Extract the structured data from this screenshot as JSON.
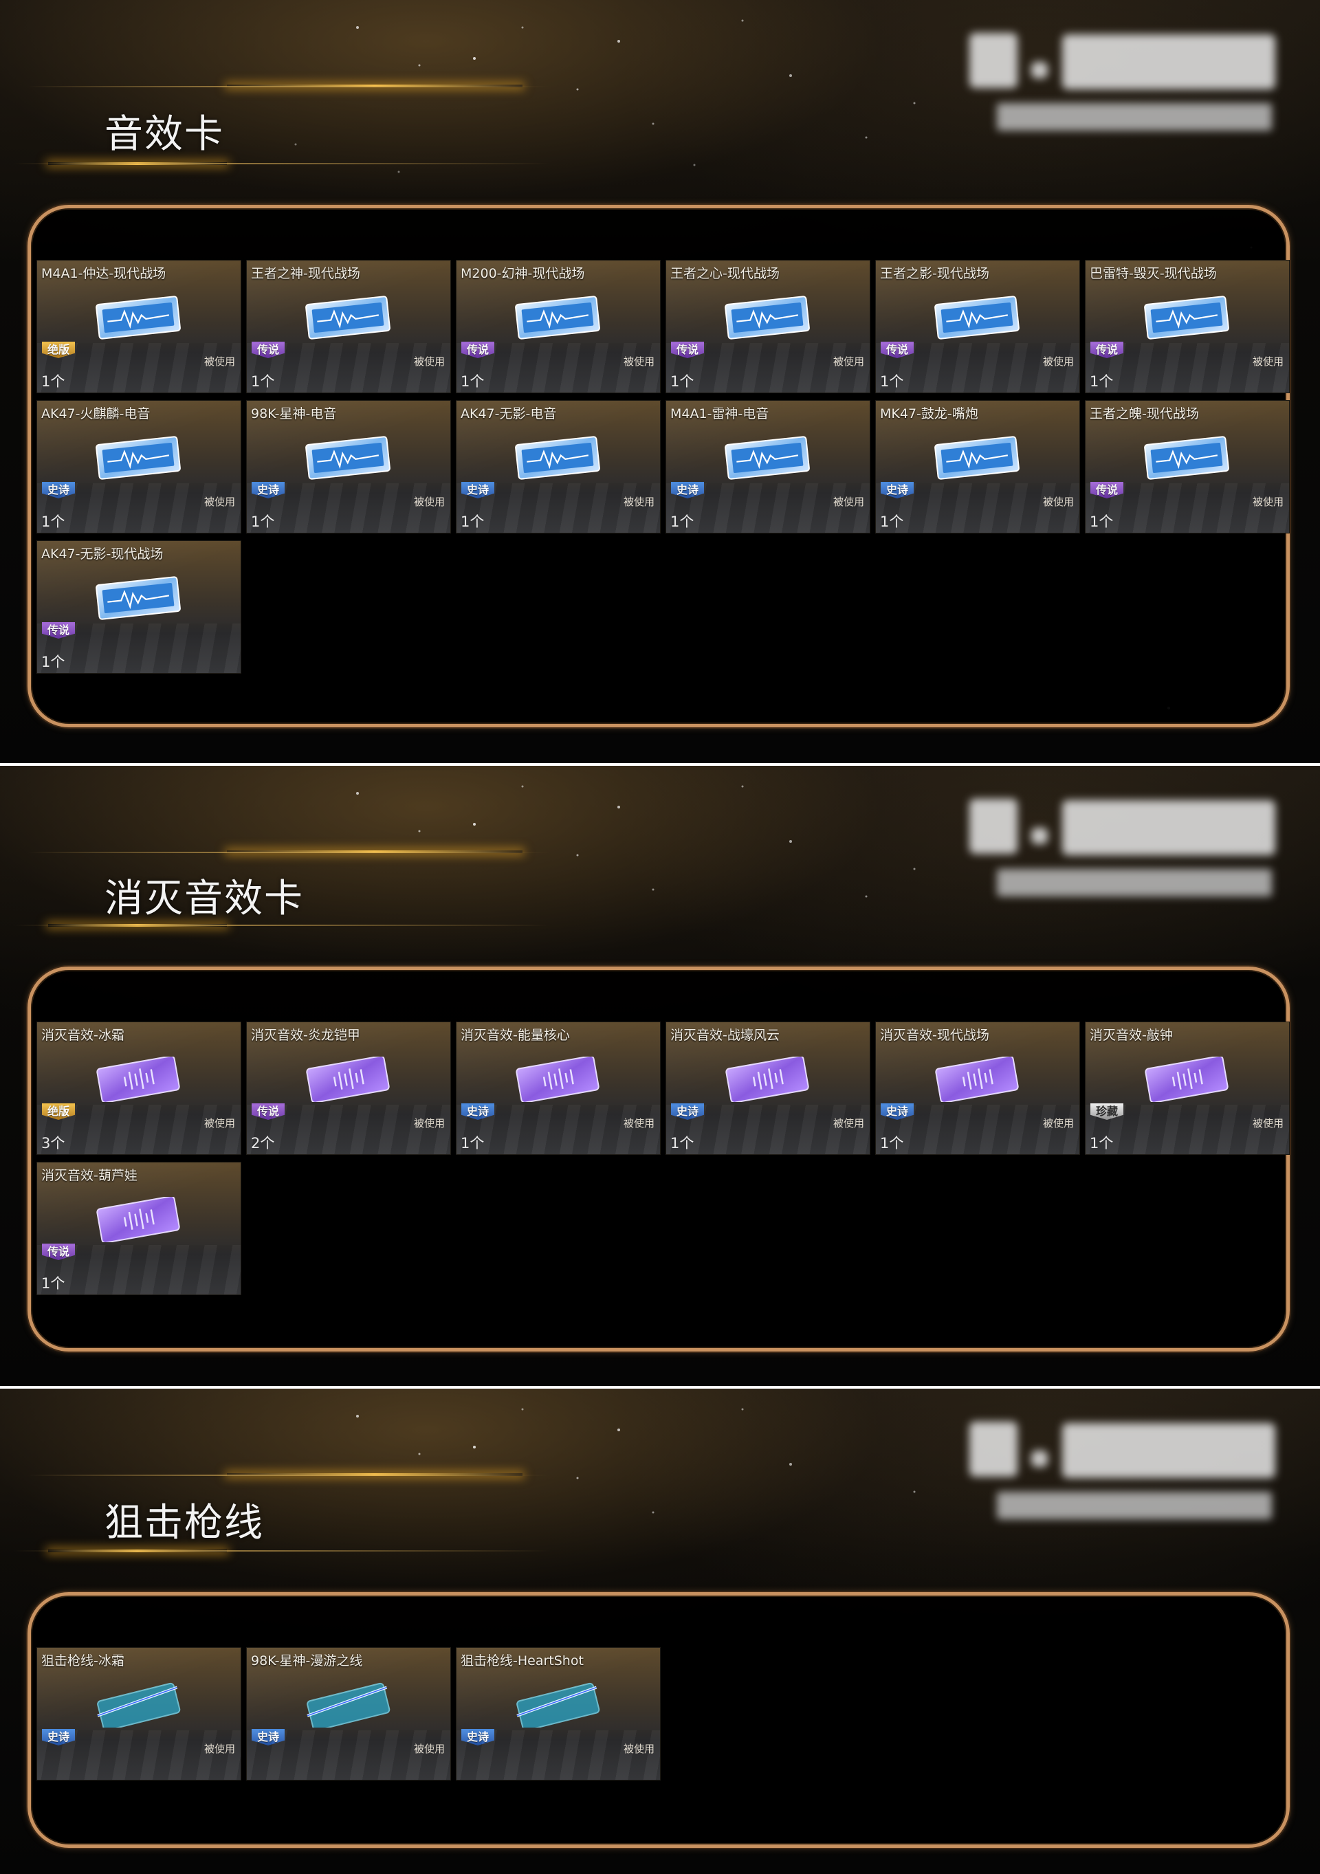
{
  "status_labels": {
    "used": "被使用"
  },
  "colors": {
    "panel_border": "#c99260",
    "rarity_legend": "#8a4fc7",
    "rarity_epic": "#3471c9",
    "rarity_peak": "#d9a12a",
    "rarity_rare": "#cfcfcf"
  },
  "sections": [
    {
      "title": "音效卡",
      "icon": "sound-card-icon",
      "items": [
        {
          "name": "M4A1-仲达-现代战场",
          "tier": "绝版",
          "tier_key": "peak",
          "used": true,
          "count": "1个"
        },
        {
          "name": "王者之神-现代战场",
          "tier": "传说",
          "tier_key": "legend",
          "used": true,
          "count": "1个"
        },
        {
          "name": "M200-幻神-现代战场",
          "tier": "传说",
          "tier_key": "legend",
          "used": true,
          "count": "1个"
        },
        {
          "name": "王者之心-现代战场",
          "tier": "传说",
          "tier_key": "legend",
          "used": true,
          "count": "1个"
        },
        {
          "name": "王者之影-现代战场",
          "tier": "传说",
          "tier_key": "legend",
          "used": true,
          "count": "1个"
        },
        {
          "name": "巴雷特-毁灭-现代战场",
          "tier": "传说",
          "tier_key": "legend",
          "used": true,
          "count": "1个"
        },
        {
          "name": "AK47-火麒麟-电音",
          "tier": "史诗",
          "tier_key": "epic",
          "used": true,
          "count": "1个"
        },
        {
          "name": "98K-星神-电音",
          "tier": "史诗",
          "tier_key": "epic",
          "used": true,
          "count": "1个"
        },
        {
          "name": "AK47-无影-电音",
          "tier": "史诗",
          "tier_key": "epic",
          "used": true,
          "count": "1个"
        },
        {
          "name": "M4A1-雷神-电音",
          "tier": "史诗",
          "tier_key": "epic",
          "used": true,
          "count": "1个"
        },
        {
          "name": "MK47-鼓龙-嘴炮",
          "tier": "史诗",
          "tier_key": "epic",
          "used": true,
          "count": "1个"
        },
        {
          "name": "王者之魄-现代战场",
          "tier": "传说",
          "tier_key": "legend",
          "used": true,
          "count": "1个"
        },
        {
          "name": "AK47-无影-现代战场",
          "tier": "传说",
          "tier_key": "legend",
          "used": false,
          "count": "1个"
        }
      ]
    },
    {
      "title": "消灭音效卡",
      "icon": "kill-sound-card-icon",
      "items": [
        {
          "name": "消灭音效-冰霜",
          "tier": "绝版",
          "tier_key": "peak",
          "used": true,
          "count": "3个"
        },
        {
          "name": "消灭音效-炎龙铠甲",
          "tier": "传说",
          "tier_key": "legend",
          "used": true,
          "count": "2个"
        },
        {
          "name": "消灭音效-能量核心",
          "tier": "史诗",
          "tier_key": "epic",
          "used": true,
          "count": "1个"
        },
        {
          "name": "消灭音效-战壕风云",
          "tier": "史诗",
          "tier_key": "epic",
          "used": true,
          "count": "1个"
        },
        {
          "name": "消灭音效-现代战场",
          "tier": "史诗",
          "tier_key": "epic",
          "used": true,
          "count": "1个"
        },
        {
          "name": "消灭音效-敲钟",
          "tier": "珍藏",
          "tier_key": "rare",
          "used": true,
          "count": "1个"
        },
        {
          "name": "消灭音效-葫芦娃",
          "tier": "传说",
          "tier_key": "legend",
          "used": false,
          "count": "1个"
        }
      ]
    },
    {
      "title": "狙击枪线",
      "icon": "sniper-line-icon",
      "items": [
        {
          "name": "狙击枪线-冰霜",
          "tier": "史诗",
          "tier_key": "epic",
          "used": true,
          "count": ""
        },
        {
          "name": "98K-星神-漫游之线",
          "tier": "史诗",
          "tier_key": "epic",
          "used": true,
          "count": ""
        },
        {
          "name": "狙击枪线-HeartShot",
          "tier": "史诗",
          "tier_key": "epic",
          "used": true,
          "count": ""
        }
      ]
    }
  ]
}
